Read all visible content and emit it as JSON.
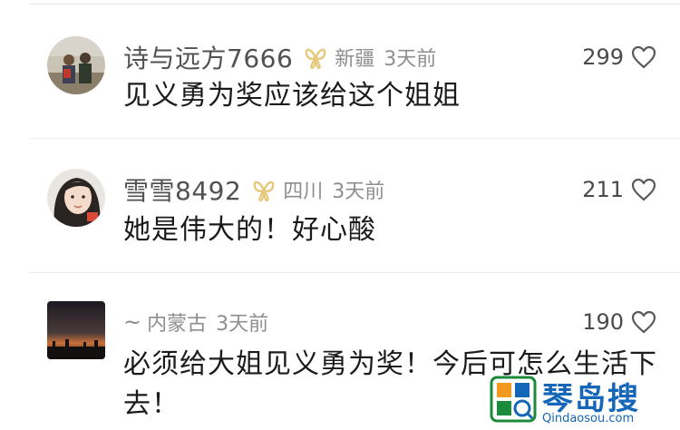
{
  "comments": [
    {
      "username": "诗与远方7666",
      "has_badge": true,
      "location": "新疆",
      "time": "3天前",
      "likes": "299",
      "text": "见义勇为奖应该给这个姐姐"
    },
    {
      "username": "雪雪8492",
      "has_badge": true,
      "location": "四川",
      "time": "3天前",
      "likes": "211",
      "text": "她是伟大的！好心酸"
    },
    {
      "username": "~",
      "has_badge": false,
      "location": "内蒙古",
      "time": "3天前",
      "likes": "190",
      "text": "必须给大姐见义勇为奖！今后可怎么生活下去！"
    }
  ],
  "watermark": {
    "name": "琴岛搜",
    "url": "Qindaosou.com"
  },
  "icons": {
    "badge": "butterfly-badge-icon",
    "like": "heart-outline-icon"
  },
  "colors": {
    "badge": "#e6c87a",
    "watermark": "#1466b8"
  }
}
